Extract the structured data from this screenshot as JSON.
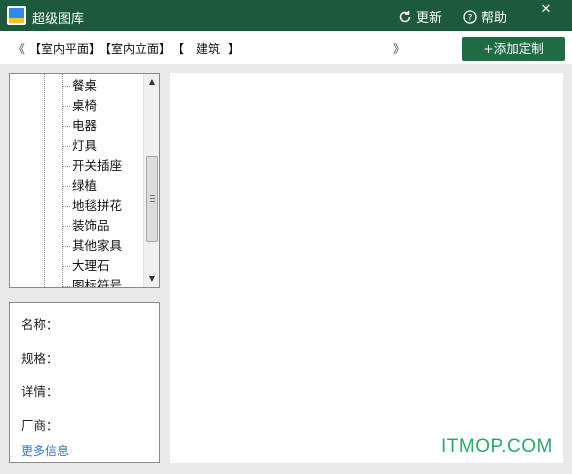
{
  "window": {
    "title": "超级图库",
    "refresh_label": "更新",
    "help_label": "帮助",
    "close_label": "✕"
  },
  "breadcrumb": {
    "prev": "《",
    "items": [
      "【室内平面】",
      "【室内立面】",
      "【",
      "建筑",
      "】"
    ],
    "next": "》"
  },
  "toolbar": {
    "add_custom_label": "+添加定制"
  },
  "tree": {
    "items": [
      "餐桌",
      "桌椅",
      "电器",
      "灯具",
      "开关插座",
      "绿植",
      "地毯拼花",
      "装饰品",
      "其他家具",
      "大理石",
      "图标符号"
    ]
  },
  "info": {
    "name_label": "名称：",
    "spec_label": "规格：",
    "detail_label": "详情：",
    "vendor_label": "厂商：",
    "more_link": "更多信息"
  },
  "watermark": "ITMOP.COM",
  "colors": {
    "titlebar": "#1d5a3c",
    "accent_button": "#1f6b44",
    "link": "#2a7ac8",
    "watermark": "#2aa86a"
  }
}
